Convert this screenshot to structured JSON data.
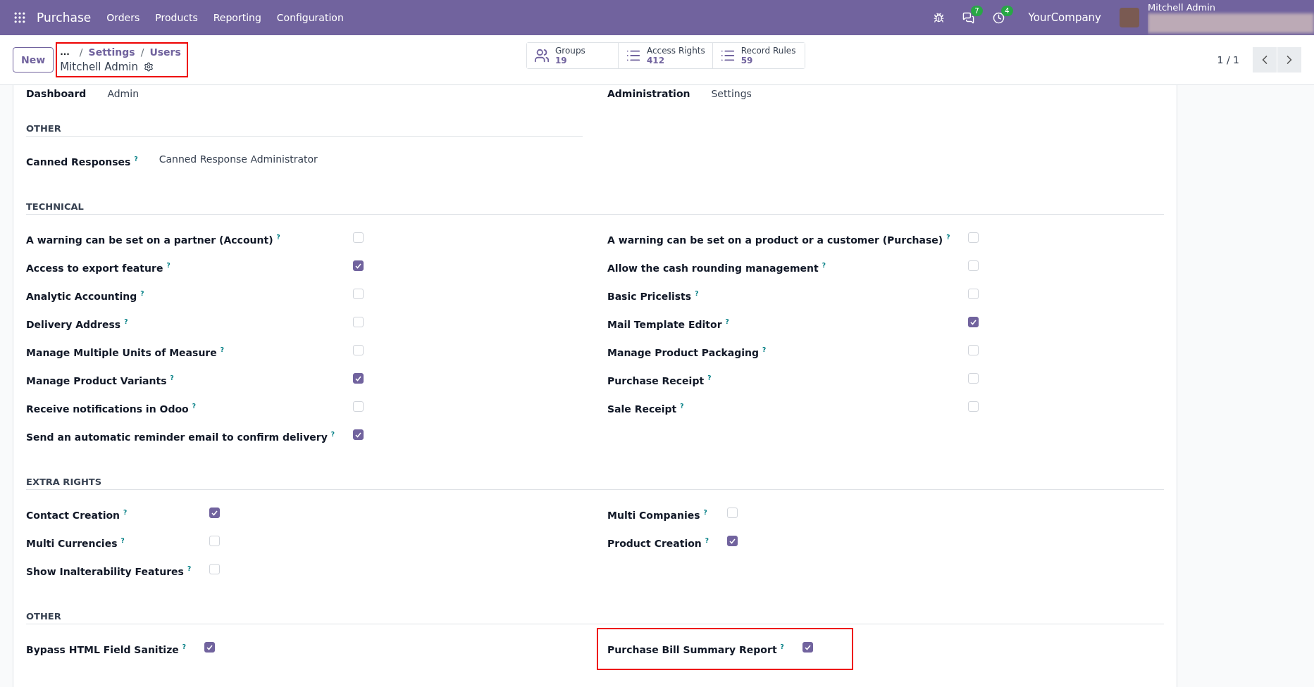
{
  "navbar": {
    "app": "Purchase",
    "menu": [
      "Orders",
      "Products",
      "Reporting",
      "Configuration"
    ],
    "chat_badge": "7",
    "activity_badge": "4",
    "company": "YourCompany",
    "user": "Mitchell Admin"
  },
  "control_panel": {
    "new_button": "New",
    "breadcrumb": {
      "ellipsis": "...",
      "separator": "/",
      "items": [
        "Settings",
        "Users"
      ],
      "current": "Mitchell Admin",
      "highlighted": true
    },
    "stats": [
      {
        "kind": "groups",
        "label": "Groups",
        "value": "19"
      },
      {
        "kind": "list",
        "label": "Access Rights",
        "value": "412"
      },
      {
        "kind": "list",
        "label": "Record Rules",
        "value": "59"
      }
    ],
    "pager": "1 / 1"
  },
  "sections": [
    {
      "kind": "fields",
      "cut": true,
      "left": [
        {
          "label": "Dashboard",
          "value": "Admin"
        }
      ],
      "right": [
        {
          "label": "Administration",
          "value": "Settings"
        }
      ]
    },
    {
      "kind": "fields",
      "title": "OTHER",
      "left": [
        {
          "label": "Canned Responses",
          "help": "?",
          "value": "Canned Response Administrator"
        }
      ]
    },
    {
      "kind": "checkboxes",
      "title": "TECHNICAL",
      "left": [
        {
          "label": "A warning can be set on a partner (Account)",
          "help": "?",
          "checked": false,
          "highlighted": false
        },
        {
          "label": "Access to export feature",
          "help": "?",
          "checked": true,
          "highlighted": false
        },
        {
          "label": "Analytic Accounting",
          "help": "?",
          "checked": false,
          "highlighted": false
        },
        {
          "label": "Delivery Address",
          "help": "?",
          "checked": false,
          "highlighted": false
        },
        {
          "label": "Manage Multiple Units of Measure",
          "help": "?",
          "checked": false,
          "highlighted": false
        },
        {
          "label": "Manage Product Variants",
          "help": "?",
          "checked": true,
          "highlighted": false
        },
        {
          "label": "Receive notifications in Odoo",
          "help": "?",
          "checked": false,
          "highlighted": false
        },
        {
          "label": "Send an automatic reminder email to confirm delivery",
          "help": "?",
          "checked": true,
          "highlighted": false
        }
      ],
      "right": [
        {
          "label": "A warning can be set on a product or a customer (Purchase)",
          "help": "?",
          "checked": false,
          "highlighted": false
        },
        {
          "label": "Allow the cash rounding management",
          "help": "?",
          "checked": false,
          "highlighted": false
        },
        {
          "label": "Basic Pricelists",
          "help": "?",
          "checked": false,
          "highlighted": false
        },
        {
          "label": "Mail Template Editor",
          "help": "?",
          "checked": true,
          "highlighted": false
        },
        {
          "label": "Manage Product Packaging",
          "help": "?",
          "checked": false,
          "highlighted": false
        },
        {
          "label": "Purchase Receipt",
          "help": "?",
          "checked": false,
          "highlighted": false
        },
        {
          "label": "Sale Receipt",
          "help": "?",
          "checked": false,
          "highlighted": false
        }
      ]
    },
    {
      "kind": "checkboxes",
      "title": "EXTRA RIGHTS",
      "left": [
        {
          "label": "Contact Creation",
          "help": "?",
          "checked": true,
          "highlighted": false
        },
        {
          "label": "Multi Currencies",
          "help": "?",
          "checked": false,
          "highlighted": false
        },
        {
          "label": "Show Inalterability Features",
          "help": "?",
          "checked": false,
          "highlighted": false
        }
      ],
      "right": [
        {
          "label": "Multi Companies",
          "help": "?",
          "checked": false,
          "highlighted": false
        },
        {
          "label": "Product Creation",
          "help": "?",
          "checked": true,
          "highlighted": false
        }
      ]
    },
    {
      "kind": "checkboxes",
      "title": "OTHER",
      "left": [
        {
          "label": "Bypass HTML Field Sanitize",
          "help": "?",
          "checked": true,
          "highlighted": false
        }
      ],
      "right": [
        {
          "label": "Purchase Bill Summary Report",
          "help": "?",
          "checked": true,
          "highlighted": true
        }
      ]
    }
  ]
}
